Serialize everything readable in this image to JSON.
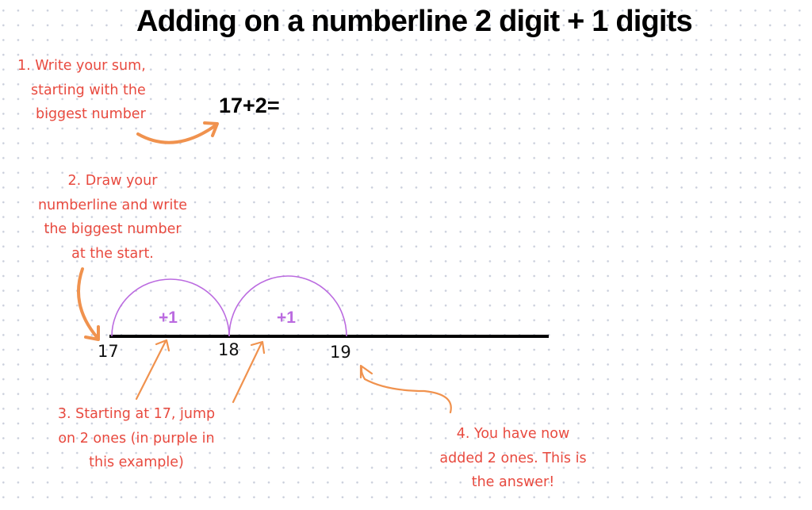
{
  "title": "Adding on a numberline 2 digit + 1 digits",
  "sum": "17+2=",
  "steps": {
    "step1": [
      "1.  Write your sum,",
      "starting with the",
      "biggest number"
    ],
    "step2": [
      "2. Draw your",
      "numberline and write",
      "the biggest number",
      "at the start."
    ],
    "step3": [
      "3. Starting at 17, jump",
      "on 2 ones (in purple in",
      "this example)"
    ],
    "step4": [
      "4. You have now",
      "added  2 ones. This is",
      "the answer!"
    ]
  },
  "numberline": {
    "ticks": [
      "17",
      "18",
      "19"
    ],
    "jumps": [
      "+1",
      "+1"
    ]
  },
  "colors": {
    "note_text": "#e84a3f",
    "arrow": "#f0924e",
    "jump": "#bb6be0",
    "line": "#000000"
  }
}
